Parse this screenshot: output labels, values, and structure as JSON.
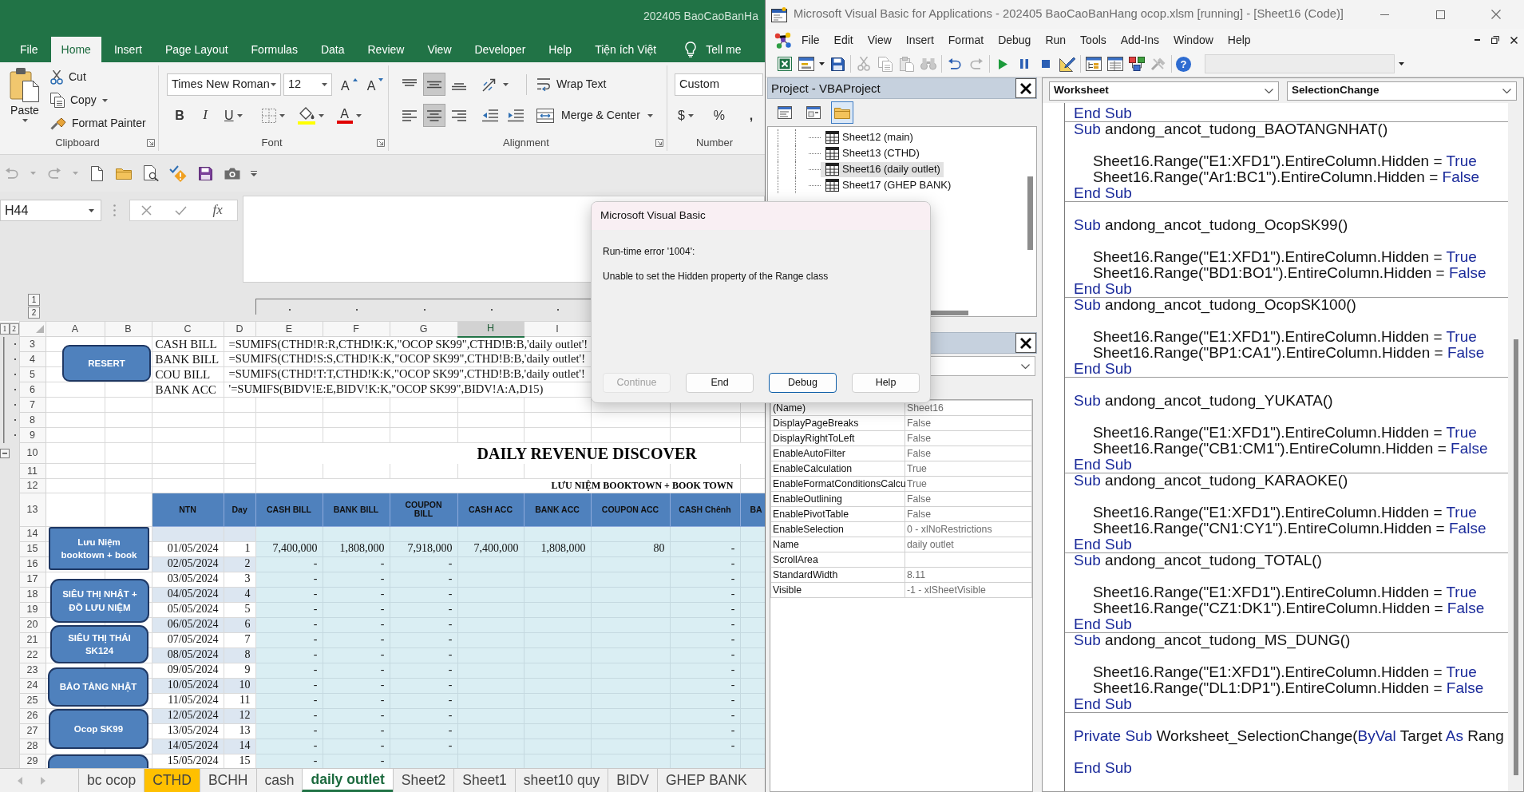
{
  "excel": {
    "title": "202405 BaoCaoBanHa",
    "ribbon_tabs": [
      {
        "label": "File",
        "selected": false
      },
      {
        "label": "Home",
        "selected": true
      },
      {
        "label": "Insert",
        "selected": false
      },
      {
        "label": "Page Layout",
        "selected": false
      },
      {
        "label": "Formulas",
        "selected": false
      },
      {
        "label": "Data",
        "selected": false
      },
      {
        "label": "Review",
        "selected": false
      },
      {
        "label": "View",
        "selected": false
      },
      {
        "label": "Developer",
        "selected": false
      },
      {
        "label": "Help",
        "selected": false
      },
      {
        "label": "Tiện ích Việt",
        "selected": false
      }
    ],
    "tell_me": "Tell me",
    "clipboard": {
      "paste": "Paste",
      "cut": "Cut",
      "copy": "Copy",
      "format_painter": "Format Painter",
      "label": "Clipboard"
    },
    "font": {
      "name": "Times New Roman",
      "size": "12",
      "grow": "A",
      "shrink": "A",
      "bold": "B",
      "italic": "I",
      "underline": "U",
      "font_color": "A",
      "label": "Font"
    },
    "alignment": {
      "vertical": [
        {
          "kind": "top",
          "selected": false
        },
        {
          "kind": "middle",
          "selected": true
        },
        {
          "kind": "bottom",
          "selected": false
        }
      ],
      "horizontal": [
        {
          "kind": "left",
          "selected": false
        },
        {
          "kind": "center",
          "selected": true
        },
        {
          "kind": "right",
          "selected": false
        }
      ],
      "wrap_text": "Wrap Text",
      "merge_center": "Merge & Center",
      "label": "Alignment"
    },
    "number": {
      "format": "Custom",
      "currency": "$",
      "percent": "%",
      "comma": ",",
      "label": "Number"
    },
    "name_box": "H44",
    "function_label": "fx",
    "sheet": {
      "column_outline_levels": [
        "1",
        "2"
      ],
      "row_outline_levels": [
        "1",
        "2"
      ],
      "row_group_expanded": true,
      "column_headers": [
        {
          "label": "A",
          "selected": false,
          "grouped": false
        },
        {
          "label": "B",
          "selected": false,
          "grouped": false
        },
        {
          "label": "C",
          "selected": false,
          "grouped": false
        },
        {
          "label": "D",
          "selected": false,
          "grouped": false
        },
        {
          "label": "E",
          "selected": false,
          "grouped": true
        },
        {
          "label": "F",
          "selected": false,
          "grouped": true
        },
        {
          "label": "G",
          "selected": false,
          "grouped": true
        },
        {
          "label": "H",
          "selected": true,
          "grouped": true
        },
        {
          "label": "I",
          "selected": false,
          "grouped": true
        }
      ],
      "rows": [
        {
          "number": "3",
          "kind": "formula",
          "grouped": true,
          "cells": {
            "C": "CASH BILL",
            "D": "=SUMIFS(CTHD!R:R,CTHD!K:K,\"OCOP SK99\",CTHD!B:B,'daily outlet'!"
          }
        },
        {
          "number": "4",
          "kind": "formula",
          "grouped": true,
          "cells": {
            "C": "BANK BILL",
            "D": "=SUMIFS(CTHD!S:S,CTHD!K:K,\"OCOP SK99\",CTHD!B:B,'daily outlet'!"
          }
        },
        {
          "number": "5",
          "kind": "formula",
          "grouped": true,
          "cells": {
            "C": "COU BILL",
            "D": "=SUMIFS(CTHD!T:T,CTHD!K:K,\"OCOP SK99\",CTHD!B:B,'daily outlet'!"
          }
        },
        {
          "number": "6",
          "kind": "formula",
          "grouped": true,
          "cells": {
            "C": "BANK ACC",
            "D": "'=SUMIFS(BIDV!E:E,BIDV!K:K,\"OCOP SK99\",BIDV!A:A,D15)"
          }
        },
        {
          "number": "7",
          "kind": "blank",
          "grouped": true
        },
        {
          "number": "8",
          "kind": "blank",
          "grouped": true
        },
        {
          "number": "9",
          "kind": "blank",
          "grouped": true
        },
        {
          "number": "10",
          "kind": "title",
          "grouped": false,
          "cells": {
            "E": "DAILY REVENUE DISCOVER"
          }
        },
        {
          "number": "11",
          "kind": "blank",
          "grouped": false
        },
        {
          "number": "12",
          "kind": "subtitle",
          "grouped": false,
          "cells": {
            "E": "LƯU NIỆM BOOKTOWN + BOOK TOWN"
          }
        },
        {
          "number": "13",
          "kind": "header",
          "grouped": false,
          "cells": {
            "C": "NTN",
            "D": "Day",
            "E": "CASH BILL",
            "F": "BANK BILL",
            "G": "COUPON BILL",
            "H": "CASH ACC",
            "I": "BANK ACC",
            "J": "COUPON ACC",
            "K": "CASH Chênh",
            "L": "BA"
          }
        },
        {
          "number": "14",
          "kind": "band",
          "grouped": false
        },
        {
          "number": "15",
          "kind": "data",
          "grouped": false,
          "cells": {
            "C": "01/05/2024",
            "D": "1",
            "E": "7,400,000",
            "F": "1,808,000",
            "G": "7,918,000",
            "H": "7,400,000",
            "I": "1,808,000",
            "J": "80",
            "K": "-"
          }
        },
        {
          "number": "16",
          "kind": "data",
          "grouped": false,
          "cells": {
            "C": "02/05/2024",
            "D": "2",
            "E": "-",
            "F": "-",
            "G": "-",
            "K": "-"
          }
        },
        {
          "number": "17",
          "kind": "data",
          "grouped": false,
          "cells": {
            "C": "03/05/2024",
            "D": "3",
            "E": "-",
            "F": "-",
            "G": "-",
            "K": "-"
          }
        },
        {
          "number": "18",
          "kind": "data",
          "grouped": false,
          "cells": {
            "C": "04/05/2024",
            "D": "4",
            "E": "-",
            "F": "-",
            "G": "-",
            "K": "-"
          }
        },
        {
          "number": "19",
          "kind": "data",
          "grouped": false,
          "cells": {
            "C": "05/05/2024",
            "D": "5",
            "E": "-",
            "F": "-",
            "G": "-",
            "K": "-"
          }
        },
        {
          "number": "20",
          "kind": "data",
          "grouped": false,
          "cells": {
            "C": "06/05/2024",
            "D": "6",
            "E": "-",
            "F": "-",
            "G": "-",
            "K": "-"
          }
        },
        {
          "number": "21",
          "kind": "data",
          "grouped": false,
          "cells": {
            "C": "07/05/2024",
            "D": "7",
            "E": "-",
            "F": "-",
            "G": "-",
            "K": "-"
          }
        },
        {
          "number": "22",
          "kind": "data",
          "grouped": false,
          "cells": {
            "C": "08/05/2024",
            "D": "8",
            "E": "-",
            "F": "-",
            "G": "-",
            "K": "-"
          }
        },
        {
          "number": "23",
          "kind": "data",
          "grouped": false,
          "cells": {
            "C": "09/05/2024",
            "D": "9",
            "E": "-",
            "F": "-",
            "G": "-",
            "K": "-"
          }
        },
        {
          "number": "24",
          "kind": "data",
          "grouped": false,
          "cells": {
            "C": "10/05/2024",
            "D": "10",
            "E": "-",
            "F": "-",
            "G": "-",
            "K": "-"
          }
        },
        {
          "number": "25",
          "kind": "data",
          "grouped": false,
          "cells": {
            "C": "11/05/2024",
            "D": "11",
            "E": "-",
            "F": "-",
            "G": "-",
            "K": "-"
          }
        },
        {
          "number": "26",
          "kind": "data",
          "grouped": false,
          "cells": {
            "C": "12/05/2024",
            "D": "12",
            "E": "-",
            "F": "-",
            "G": "-",
            "K": "-"
          }
        },
        {
          "number": "27",
          "kind": "data",
          "grouped": false,
          "cells": {
            "C": "13/05/2024",
            "D": "13",
            "E": "-",
            "F": "-",
            "G": "-",
            "K": "-"
          }
        },
        {
          "number": "28",
          "kind": "data",
          "grouped": false,
          "cells": {
            "C": "14/05/2024",
            "D": "14",
            "E": "-",
            "F": "-",
            "G": "-",
            "K": "-"
          }
        },
        {
          "number": "29",
          "kind": "data",
          "grouped": false,
          "cells": {
            "C": "15/05/2024",
            "D": "15",
            "E": "-",
            "F": "-"
          }
        }
      ],
      "shapes": [
        {
          "kind": "macro_button",
          "text": "RESERT"
        },
        {
          "kind": "macro_button",
          "text": "Lưu Niệm booktown + book"
        },
        {
          "kind": "macro_button",
          "text": "SIÊU THỊ NHẬT + ĐỒ LƯU NIỆM"
        },
        {
          "kind": "macro_button",
          "text": "SIÊU THỊ THÁI SK124"
        },
        {
          "kind": "macro_button",
          "text": "BẢO TÀNG NHẬT"
        },
        {
          "kind": "macro_button",
          "text": "Ocop SK99"
        },
        {
          "kind": "macro_button"
        }
      ]
    },
    "sheet_tabs": [
      {
        "label": "bc ocop",
        "selected": false
      },
      {
        "label": "CTHD",
        "selected": false,
        "color": "#ffc000"
      },
      {
        "label": "BCHH",
        "selected": false
      },
      {
        "label": "cash",
        "selected": false
      },
      {
        "label": "daily outlet",
        "selected": true
      },
      {
        "label": "Sheet2",
        "selected": false
      },
      {
        "label": "Sheet1",
        "selected": false
      },
      {
        "label": "sheet10 quy",
        "selected": false
      },
      {
        "label": "BIDV",
        "selected": false
      },
      {
        "label": "GHEP BANK",
        "selected": false
      }
    ]
  },
  "vba": {
    "title": "Microsoft Visual Basic for Applications - 202405 BaoCaoBanHang ocop.xlsm [running] - [Sheet16 (Code)]",
    "menu": [
      "File",
      "Edit",
      "View",
      "Insert",
      "Format",
      "Debug",
      "Run",
      "Tools",
      "Add-Ins",
      "Window",
      "Help"
    ],
    "help_glyph": "?",
    "project": {
      "title": "Project - VBAProject",
      "folders_toggled": true,
      "items": [
        {
          "label": "Sheet12 (main)",
          "selected": false
        },
        {
          "label": "Sheet13 (CTHD)",
          "selected": false
        },
        {
          "label": "Sheet16 (daily outlet)",
          "selected": true
        },
        {
          "label": "Sheet17 (GHEP BANK)",
          "selected": false
        }
      ]
    },
    "properties": [
      {
        "name": "(Name)",
        "value": "Sheet16"
      },
      {
        "name": "DisplayPageBreaks",
        "value": "False"
      },
      {
        "name": "DisplayRightToLeft",
        "value": "False"
      },
      {
        "name": "EnableAutoFilter",
        "value": "False"
      },
      {
        "name": "EnableCalculation",
        "value": "True"
      },
      {
        "name": "EnableFormatConditionsCalcu",
        "value": "True"
      },
      {
        "name": "EnableOutlining",
        "value": "False"
      },
      {
        "name": "EnablePivotTable",
        "value": "False"
      },
      {
        "name": "EnableSelection",
        "value": "0 - xlNoRestrictions"
      },
      {
        "name": "Name",
        "value": "daily outlet"
      },
      {
        "name": "ScrollArea"
      },
      {
        "name": "StandardWidth",
        "value": "8.11"
      },
      {
        "name": "Visible",
        "value": "-1 - xlSheetVisible"
      }
    ],
    "code": {
      "object": "Worksheet",
      "procedure": "SelectionChange",
      "lines": [
        {
          "kind": "line",
          "tokens": [
            {
              "text": "End Sub",
              "keyword": true
            }
          ]
        },
        {
          "kind": "separator"
        },
        {
          "kind": "line",
          "tokens": [
            {
              "text": "Sub",
              "keyword": true
            },
            {
              "text": " andong_ancot_tudong_BAOTANGNHAT()",
              "keyword": false
            }
          ]
        },
        {
          "kind": "blank"
        },
        {
          "kind": "indented",
          "tokens": [
            {
              "text": "Sheet16.Range(\"E1:XFD1\").EntireColumn.Hidden = ",
              "keyword": false
            },
            {
              "text": "True",
              "keyword": true
            }
          ]
        },
        {
          "kind": "indented",
          "tokens": [
            {
              "text": "Sheet16.Range(\"Ar1:BC1\").EntireColumn.Hidden = ",
              "keyword": false
            },
            {
              "text": "False",
              "keyword": true
            }
          ]
        },
        {
          "kind": "line",
          "tokens": [
            {
              "text": "End Sub",
              "keyword": true
            }
          ]
        },
        {
          "kind": "separator"
        },
        {
          "kind": "blank"
        },
        {
          "kind": "line",
          "tokens": [
            {
              "text": "Sub",
              "keyword": true
            },
            {
              "text": " andong_ancot_tudong_OcopSK99()",
              "keyword": false
            }
          ]
        },
        {
          "kind": "blank"
        },
        {
          "kind": "indented",
          "tokens": [
            {
              "text": "Sheet16.Range(\"E1:XFD1\").EntireColumn.Hidden = ",
              "keyword": false
            },
            {
              "text": "True",
              "keyword": true
            }
          ]
        },
        {
          "kind": "indented",
          "tokens": [
            {
              "text": "Sheet16.Range(\"BD1:BO1\").EntireColumn.Hidden = ",
              "keyword": false
            },
            {
              "text": "False",
              "keyword": true
            }
          ]
        },
        {
          "kind": "line",
          "tokens": [
            {
              "text": "End Sub",
              "keyword": true
            }
          ]
        },
        {
          "kind": "separator"
        },
        {
          "kind": "line",
          "tokens": [
            {
              "text": "Sub",
              "keyword": true
            },
            {
              "text": " andong_ancot_tudong_OcopSK100()",
              "keyword": false
            }
          ]
        },
        {
          "kind": "blank"
        },
        {
          "kind": "indented",
          "tokens": [
            {
              "text": "Sheet16.Range(\"E1:XFD1\").EntireColumn.Hidden = ",
              "keyword": false
            },
            {
              "text": "True",
              "keyword": true
            }
          ]
        },
        {
          "kind": "indented",
          "tokens": [
            {
              "text": "Sheet16.Range(\"BP1:CA1\").EntireColumn.Hidden = ",
              "keyword": false
            },
            {
              "text": "False",
              "keyword": true
            }
          ]
        },
        {
          "kind": "line",
          "tokens": [
            {
              "text": "End Sub",
              "keyword": true
            }
          ]
        },
        {
          "kind": "separator"
        },
        {
          "kind": "blank"
        },
        {
          "kind": "line",
          "tokens": [
            {
              "text": "Sub",
              "keyword": true
            },
            {
              "text": " andong_ancot_tudong_YUKATA()",
              "keyword": false
            }
          ]
        },
        {
          "kind": "blank"
        },
        {
          "kind": "indented",
          "tokens": [
            {
              "text": "Sheet16.Range(\"E1:XFD1\").EntireColumn.Hidden = ",
              "keyword": false
            },
            {
              "text": "True",
              "keyword": true
            }
          ]
        },
        {
          "kind": "indented",
          "tokens": [
            {
              "text": "Sheet16.Range(\"CB1:CM1\").EntireColumn.Hidden = ",
              "keyword": false
            },
            {
              "text": "False",
              "keyword": true
            }
          ]
        },
        {
          "kind": "line",
          "tokens": [
            {
              "text": "End Sub",
              "keyword": true
            }
          ]
        },
        {
          "kind": "separator"
        },
        {
          "kind": "line",
          "tokens": [
            {
              "text": "Sub",
              "keyword": true
            },
            {
              "text": " andong_ancot_tudong_KARAOKE()",
              "keyword": false
            }
          ]
        },
        {
          "kind": "blank"
        },
        {
          "kind": "indented",
          "tokens": [
            {
              "text": "Sheet16.Range(\"E1:XFD1\").EntireColumn.Hidden = ",
              "keyword": false
            },
            {
              "text": "True",
              "keyword": true
            }
          ]
        },
        {
          "kind": "indented",
          "tokens": [
            {
              "text": "Sheet16.Range(\"CN1:CY1\").EntireColumn.Hidden = ",
              "keyword": false
            },
            {
              "text": "False",
              "keyword": true
            }
          ]
        },
        {
          "kind": "line",
          "tokens": [
            {
              "text": "End Sub",
              "keyword": true
            }
          ]
        },
        {
          "kind": "separator"
        },
        {
          "kind": "line",
          "tokens": [
            {
              "text": "Sub",
              "keyword": true
            },
            {
              "text": " andong_ancot_tudong_TOTAL()",
              "keyword": false
            }
          ]
        },
        {
          "kind": "blank"
        },
        {
          "kind": "indented",
          "tokens": [
            {
              "text": "Sheet16.Range(\"E1:XFD1\").EntireColumn.Hidden = ",
              "keyword": false
            },
            {
              "text": "True",
              "keyword": true
            }
          ]
        },
        {
          "kind": "indented",
          "tokens": [
            {
              "text": "Sheet16.Range(\"CZ1:DK1\").EntireColumn.Hidden = ",
              "keyword": false
            },
            {
              "text": "False",
              "keyword": true
            }
          ]
        },
        {
          "kind": "line",
          "tokens": [
            {
              "text": "End Sub",
              "keyword": true
            }
          ]
        },
        {
          "kind": "separator"
        },
        {
          "kind": "line",
          "tokens": [
            {
              "text": "Sub",
              "keyword": true
            },
            {
              "text": " andong_ancot_tudong_MS_DUNG()",
              "keyword": false
            }
          ]
        },
        {
          "kind": "blank"
        },
        {
          "kind": "indented",
          "tokens": [
            {
              "text": "Sheet16.Range(\"E1:XFD1\").EntireColumn.Hidden = ",
              "keyword": false
            },
            {
              "text": "True",
              "keyword": true
            }
          ]
        },
        {
          "kind": "indented",
          "tokens": [
            {
              "text": "Sheet16.Range(\"DL1:DP1\").EntireColumn.Hidden = ",
              "keyword": false
            },
            {
              "text": "False",
              "keyword": true
            }
          ]
        },
        {
          "kind": "line",
          "tokens": [
            {
              "text": "End Sub",
              "keyword": true
            }
          ]
        },
        {
          "kind": "separator"
        },
        {
          "kind": "blank"
        },
        {
          "kind": "line",
          "tokens": [
            {
              "text": "Private Sub",
              "keyword": true
            },
            {
              "text": " Worksheet_SelectionChange(",
              "keyword": false
            },
            {
              "text": "ByVal",
              "keyword": true
            },
            {
              "text": " Target ",
              "keyword": false
            },
            {
              "text": "As",
              "keyword": true
            },
            {
              "text": " Rang",
              "keyword": false
            }
          ]
        },
        {
          "kind": "blank"
        },
        {
          "kind": "line",
          "tokens": [
            {
              "text": "End Sub",
              "keyword": true
            }
          ]
        }
      ]
    }
  },
  "dialog": {
    "title": "Microsoft Visual Basic",
    "error": "Run-time error '1004':",
    "message": "Unable to set the Hidden property of the Range class",
    "buttons": [
      {
        "label": "Continue",
        "disabled": true,
        "default": false
      },
      {
        "label": "End",
        "disabled": false,
        "default": false
      },
      {
        "label": "Debug",
        "disabled": false,
        "default": true
      },
      {
        "label": "Help",
        "disabled": false,
        "default": false
      }
    ]
  }
}
